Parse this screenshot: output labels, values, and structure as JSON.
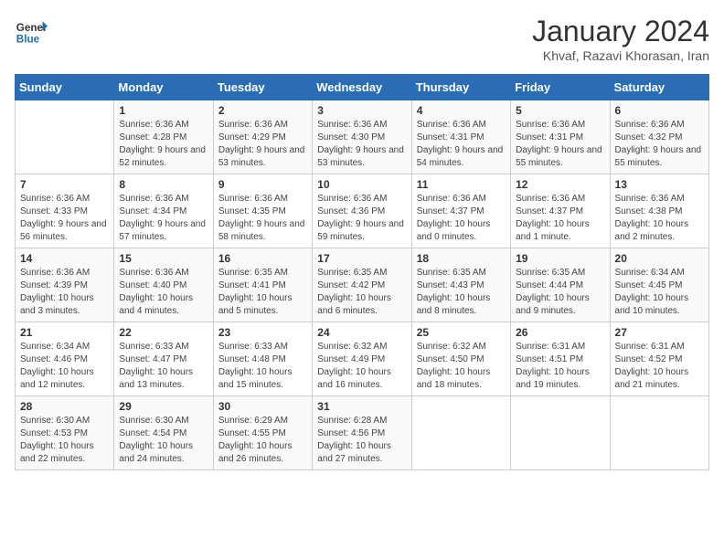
{
  "header": {
    "logo_line1": "General",
    "logo_line2": "Blue",
    "month": "January 2024",
    "location": "Khvaf, Razavi Khorasan, Iran"
  },
  "days_of_week": [
    "Sunday",
    "Monday",
    "Tuesday",
    "Wednesday",
    "Thursday",
    "Friday",
    "Saturday"
  ],
  "weeks": [
    [
      {
        "day": "",
        "sunrise": "",
        "sunset": "",
        "daylight": ""
      },
      {
        "day": "1",
        "sunrise": "Sunrise: 6:36 AM",
        "sunset": "Sunset: 4:28 PM",
        "daylight": "Daylight: 9 hours and 52 minutes."
      },
      {
        "day": "2",
        "sunrise": "Sunrise: 6:36 AM",
        "sunset": "Sunset: 4:29 PM",
        "daylight": "Daylight: 9 hours and 53 minutes."
      },
      {
        "day": "3",
        "sunrise": "Sunrise: 6:36 AM",
        "sunset": "Sunset: 4:30 PM",
        "daylight": "Daylight: 9 hours and 53 minutes."
      },
      {
        "day": "4",
        "sunrise": "Sunrise: 6:36 AM",
        "sunset": "Sunset: 4:31 PM",
        "daylight": "Daylight: 9 hours and 54 minutes."
      },
      {
        "day": "5",
        "sunrise": "Sunrise: 6:36 AM",
        "sunset": "Sunset: 4:31 PM",
        "daylight": "Daylight: 9 hours and 55 minutes."
      },
      {
        "day": "6",
        "sunrise": "Sunrise: 6:36 AM",
        "sunset": "Sunset: 4:32 PM",
        "daylight": "Daylight: 9 hours and 55 minutes."
      }
    ],
    [
      {
        "day": "7",
        "sunrise": "Sunrise: 6:36 AM",
        "sunset": "Sunset: 4:33 PM",
        "daylight": "Daylight: 9 hours and 56 minutes."
      },
      {
        "day": "8",
        "sunrise": "Sunrise: 6:36 AM",
        "sunset": "Sunset: 4:34 PM",
        "daylight": "Daylight: 9 hours and 57 minutes."
      },
      {
        "day": "9",
        "sunrise": "Sunrise: 6:36 AM",
        "sunset": "Sunset: 4:35 PM",
        "daylight": "Daylight: 9 hours and 58 minutes."
      },
      {
        "day": "10",
        "sunrise": "Sunrise: 6:36 AM",
        "sunset": "Sunset: 4:36 PM",
        "daylight": "Daylight: 9 hours and 59 minutes."
      },
      {
        "day": "11",
        "sunrise": "Sunrise: 6:36 AM",
        "sunset": "Sunset: 4:37 PM",
        "daylight": "Daylight: 10 hours and 0 minutes."
      },
      {
        "day": "12",
        "sunrise": "Sunrise: 6:36 AM",
        "sunset": "Sunset: 4:37 PM",
        "daylight": "Daylight: 10 hours and 1 minute."
      },
      {
        "day": "13",
        "sunrise": "Sunrise: 6:36 AM",
        "sunset": "Sunset: 4:38 PM",
        "daylight": "Daylight: 10 hours and 2 minutes."
      }
    ],
    [
      {
        "day": "14",
        "sunrise": "Sunrise: 6:36 AM",
        "sunset": "Sunset: 4:39 PM",
        "daylight": "Daylight: 10 hours and 3 minutes."
      },
      {
        "day": "15",
        "sunrise": "Sunrise: 6:36 AM",
        "sunset": "Sunset: 4:40 PM",
        "daylight": "Daylight: 10 hours and 4 minutes."
      },
      {
        "day": "16",
        "sunrise": "Sunrise: 6:35 AM",
        "sunset": "Sunset: 4:41 PM",
        "daylight": "Daylight: 10 hours and 5 minutes."
      },
      {
        "day": "17",
        "sunrise": "Sunrise: 6:35 AM",
        "sunset": "Sunset: 4:42 PM",
        "daylight": "Daylight: 10 hours and 6 minutes."
      },
      {
        "day": "18",
        "sunrise": "Sunrise: 6:35 AM",
        "sunset": "Sunset: 4:43 PM",
        "daylight": "Daylight: 10 hours and 8 minutes."
      },
      {
        "day": "19",
        "sunrise": "Sunrise: 6:35 AM",
        "sunset": "Sunset: 4:44 PM",
        "daylight": "Daylight: 10 hours and 9 minutes."
      },
      {
        "day": "20",
        "sunrise": "Sunrise: 6:34 AM",
        "sunset": "Sunset: 4:45 PM",
        "daylight": "Daylight: 10 hours and 10 minutes."
      }
    ],
    [
      {
        "day": "21",
        "sunrise": "Sunrise: 6:34 AM",
        "sunset": "Sunset: 4:46 PM",
        "daylight": "Daylight: 10 hours and 12 minutes."
      },
      {
        "day": "22",
        "sunrise": "Sunrise: 6:33 AM",
        "sunset": "Sunset: 4:47 PM",
        "daylight": "Daylight: 10 hours and 13 minutes."
      },
      {
        "day": "23",
        "sunrise": "Sunrise: 6:33 AM",
        "sunset": "Sunset: 4:48 PM",
        "daylight": "Daylight: 10 hours and 15 minutes."
      },
      {
        "day": "24",
        "sunrise": "Sunrise: 6:32 AM",
        "sunset": "Sunset: 4:49 PM",
        "daylight": "Daylight: 10 hours and 16 minutes."
      },
      {
        "day": "25",
        "sunrise": "Sunrise: 6:32 AM",
        "sunset": "Sunset: 4:50 PM",
        "daylight": "Daylight: 10 hours and 18 minutes."
      },
      {
        "day": "26",
        "sunrise": "Sunrise: 6:31 AM",
        "sunset": "Sunset: 4:51 PM",
        "daylight": "Daylight: 10 hours and 19 minutes."
      },
      {
        "day": "27",
        "sunrise": "Sunrise: 6:31 AM",
        "sunset": "Sunset: 4:52 PM",
        "daylight": "Daylight: 10 hours and 21 minutes."
      }
    ],
    [
      {
        "day": "28",
        "sunrise": "Sunrise: 6:30 AM",
        "sunset": "Sunset: 4:53 PM",
        "daylight": "Daylight: 10 hours and 22 minutes."
      },
      {
        "day": "29",
        "sunrise": "Sunrise: 6:30 AM",
        "sunset": "Sunset: 4:54 PM",
        "daylight": "Daylight: 10 hours and 24 minutes."
      },
      {
        "day": "30",
        "sunrise": "Sunrise: 6:29 AM",
        "sunset": "Sunset: 4:55 PM",
        "daylight": "Daylight: 10 hours and 26 minutes."
      },
      {
        "day": "31",
        "sunrise": "Sunrise: 6:28 AM",
        "sunset": "Sunset: 4:56 PM",
        "daylight": "Daylight: 10 hours and 27 minutes."
      },
      {
        "day": "",
        "sunrise": "",
        "sunset": "",
        "daylight": ""
      },
      {
        "day": "",
        "sunrise": "",
        "sunset": "",
        "daylight": ""
      },
      {
        "day": "",
        "sunrise": "",
        "sunset": "",
        "daylight": ""
      }
    ]
  ]
}
